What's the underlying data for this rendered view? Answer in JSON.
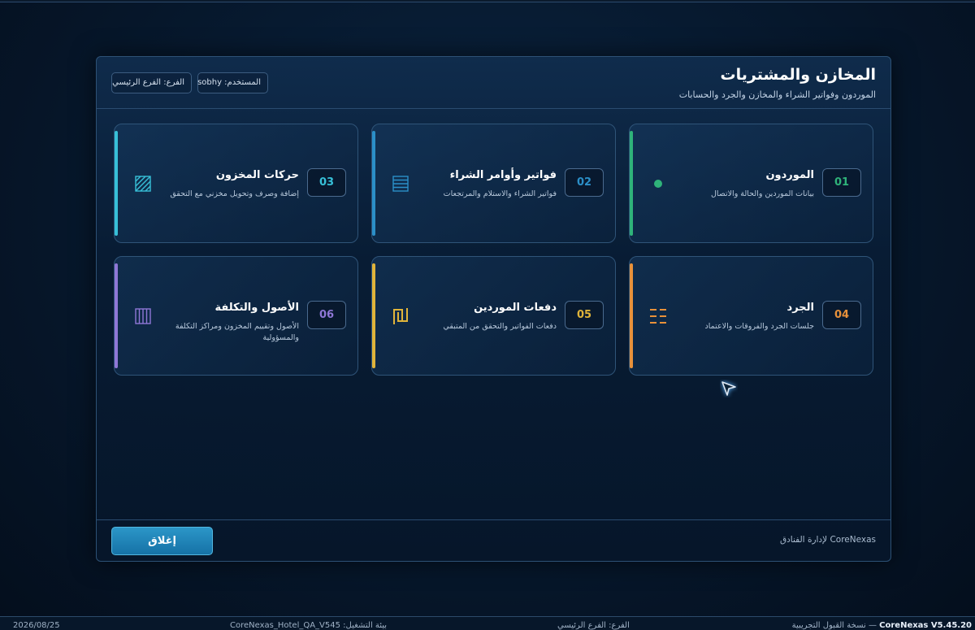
{
  "dialog": {
    "title": "المخازن والمشتريات",
    "subtitle": "الموردون وفواتير الشراء والمخازن والجرد والحسابات",
    "user_chip": "المستخدم: sobhy",
    "branch_chip": "الفرع: الفرع الرئيسي",
    "footer_brand": "CoreNexas لإدارة الفنادق",
    "close_label": "إغلاق"
  },
  "cards": [
    {
      "num": "01",
      "title": "الموردون",
      "desc": "بيانات الموردين والحالة والاتصال",
      "color": "#2fb37a",
      "icon": "dot-icon"
    },
    {
      "num": "02",
      "title": "فواتير وأوامر الشراء",
      "desc": "فواتير الشراء والاستلام والمرتجعات",
      "color": "#2b8fc8",
      "icon": "list-lines-icon"
    },
    {
      "num": "03",
      "title": "حركات المخزون",
      "desc": "إضافة وصرف وتحويل مخزني مع التحقق",
      "color": "#37c0d8",
      "icon": "hatched-square-icon"
    },
    {
      "num": "04",
      "title": "الجرد",
      "desc": "جلسات الجرد والفروقات والاعتماد",
      "color": "#e8913a",
      "icon": "dashed-lines-icon"
    },
    {
      "num": "05",
      "title": "دفعات الموردين",
      "desc": "دفعات الفواتير والتحقق من المتبقي",
      "color": "#e0b43a",
      "icon": "shekel-icon"
    },
    {
      "num": "06",
      "title": "الأصول والتكلفة",
      "desc": "الأصول وتقييم المخزون ومراكز التكلفة والمسؤولية",
      "color": "#8f77d6",
      "icon": "vertical-bars-icon"
    }
  ],
  "statusbar": {
    "date": "2026/08/25",
    "env": "بيئة التشغيل: CoreNexas_Hotel_QA_V545",
    "branch": "الفرع: الفرع الرئيسي",
    "version_name": "CoreNexas V5.45.20",
    "version_note": "— نسخة القبول التجريبية"
  }
}
